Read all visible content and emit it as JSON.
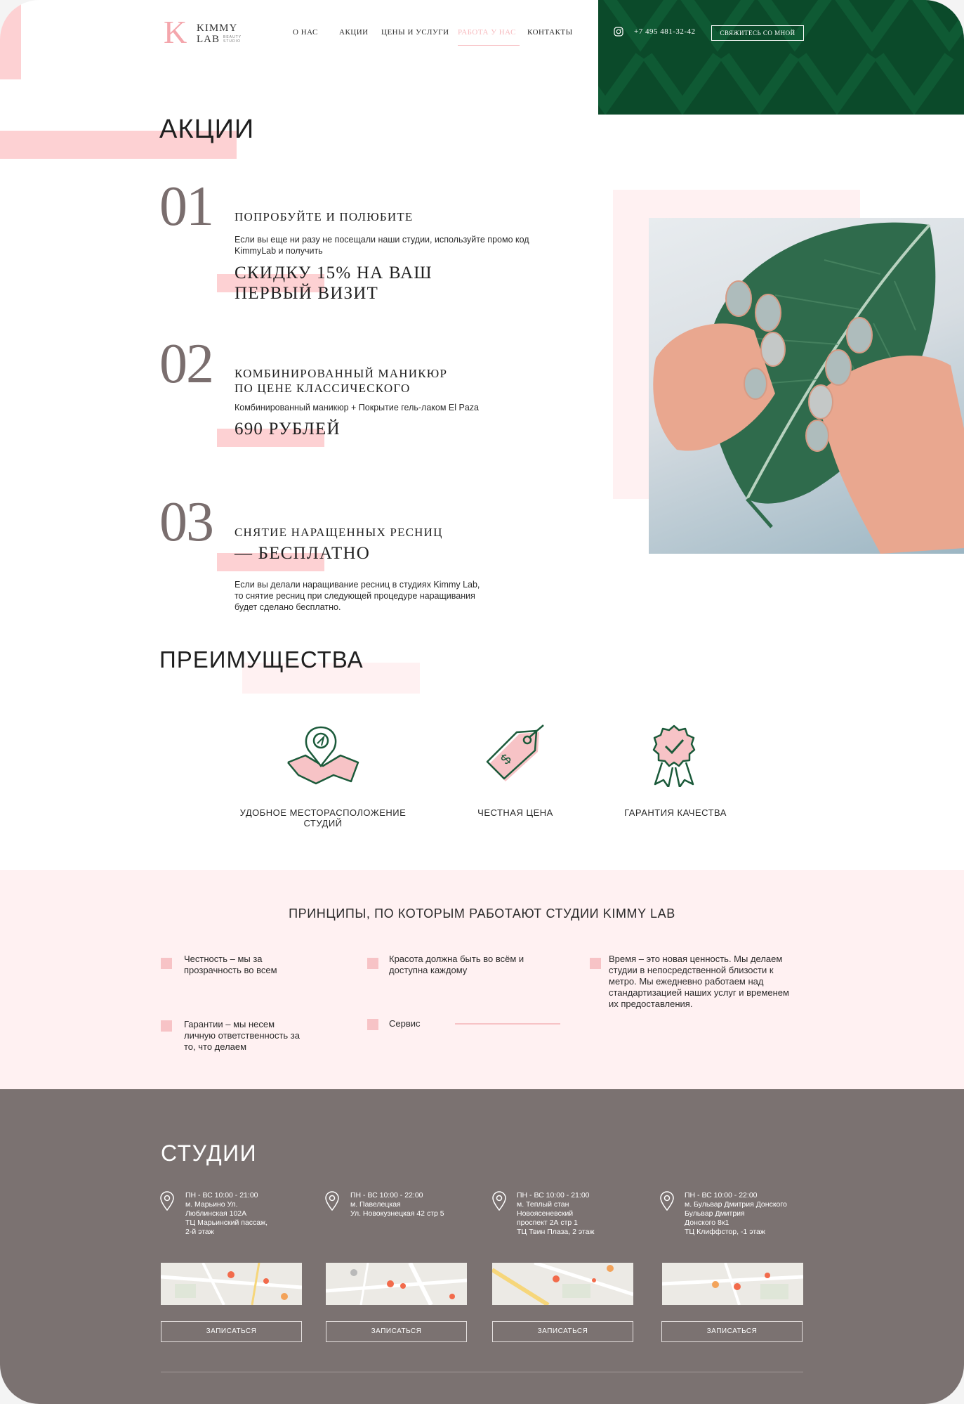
{
  "header": {
    "logo_letter": "K",
    "logo_line1": "KIMMY",
    "logo_line2": "LAB",
    "logo_sub": "BEAUTY STUDIO",
    "nav": [
      "О НАС",
      "АКЦИИ",
      "ЦЕНЫ И УСЛУГИ",
      "РАБОТА У НАС",
      "КОНТАКТЫ"
    ],
    "nav_active_index": 3,
    "phone": "+7 495 481-32-42",
    "contact_button": "СВЯЖИТЕСЬ СО МНОЙ",
    "instagram_icon": "instagram-icon"
  },
  "promos": {
    "title": "АКЦИИ",
    "items": [
      {
        "number": "01",
        "title": "ПОПРОБУЙТЕ И ПОЛЮБИТЕ",
        "text": "Если вы еще ни разу не посещали наши студии, используйте промо код KimmyLab и получить",
        "big_line1": "СКИДКУ 15% НА ВАШ",
        "big_line2": "ПЕРВЫЙ ВИЗИТ"
      },
      {
        "number": "02",
        "title_line1": "КОМБИНИРОВАННЫЙ МАНИКЮР",
        "title_line2": "ПО ЦЕНЕ КЛАССИЧЕСКОГО",
        "text": "Комбинированный маникюр + Покрытие гель-лаком El Paza",
        "big": "690 РУБЛЕЙ"
      },
      {
        "number": "03",
        "title": "СНЯТИЕ НАРАЩЕННЫХ РЕСНИЦ",
        "big": "— БЕСПЛАТНО",
        "text": "Если вы делали наращивание ресниц в студиях Kimmy Lab, то снятие ресниц при следующей процедуре наращивания будет сделано бесплатно."
      }
    ]
  },
  "advantages": {
    "title": "ПРЕИМУЩЕСТВА",
    "items": [
      {
        "label": "УДОБНОЕ МЕСТОРАСПОЛОЖЕНИЕ СТУДИЙ",
        "icon": "map-location-icon"
      },
      {
        "label": "ЧЕСТНАЯ ЦЕНА",
        "icon": "price-tag-icon"
      },
      {
        "label": "ГАРАНТИЯ КАЧЕСТВА",
        "icon": "quality-badge-icon"
      }
    ]
  },
  "principles": {
    "title": "ПРИНЦИПЫ, ПО КОТОРЫМ РАБОТАЮТ СТУДИИ KIMMY LAB",
    "items": [
      "Честность – мы за прозрачность во всем",
      "Красота должна быть во всём и доступна каждому",
      "Время – это новая ценность. Мы делаем студии в непосредственной близости к метро. Мы ежедневно работаем над стандартизацией наших услуг и временем их предоставления.",
      "Гарантии – мы несем личную ответственность за то, что делаем",
      "Сервис"
    ]
  },
  "studios": {
    "title": "СТУДИИ",
    "book_label": "ЗАПИСАТЬСЯ",
    "items": [
      {
        "lines": [
          "ПН - ВС 10:00 - 21:00",
          "м. Марьино Ул.",
          "Люблинская 102А",
          "ТЦ Марьинский пассаж,",
          "2-й этаж"
        ]
      },
      {
        "lines": [
          "ПН - ВС 10:00 - 22:00",
          "м. Павелецкая",
          "Ул. Новокузнецкая 42 стр 5"
        ]
      },
      {
        "lines": [
          "ПН - ВС 10:00 - 21:00",
          "м. Теплый стан",
          "Новоясеневский",
          "проспект 2А стр 1",
          "ТЦ Твин Плаза, 2 этаж"
        ]
      },
      {
        "lines": [
          "ПН - ВС 10:00 - 22:00",
          "м. Бульвар Дмитрия Донского",
          "Бульвар Дмитрия",
          "Донского 8к1",
          "ТЦ Клиффстор, -1 этаж"
        ]
      }
    ]
  },
  "colors": {
    "accent_pink": "#fdd1d3",
    "header_green": "#0b4a2a",
    "studios_bg": "#7b7271",
    "numbers": "#7a6e6e"
  }
}
